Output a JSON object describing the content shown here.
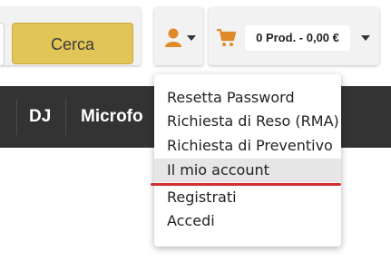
{
  "header": {
    "search_button_label": "Cerca",
    "user_icon": "user-icon",
    "cart": {
      "icon": "cart-icon",
      "total_label": "0 Prod. - 0,00 €"
    }
  },
  "nav": {
    "items": [
      "DJ",
      "Microfo"
    ]
  },
  "account_menu": {
    "items": [
      "Resetta Password",
      "Richiesta di Reso (RMA)",
      "Richiesta di Preventivo",
      "Il mio account",
      "Registrati",
      "Accedi"
    ],
    "highlighted_item": "Il mio account"
  },
  "colors": {
    "search_button": "#e2c557",
    "icon_accent": "#e08a2a",
    "navbar": "#333333",
    "highlight_underline": "#d32f2f"
  }
}
